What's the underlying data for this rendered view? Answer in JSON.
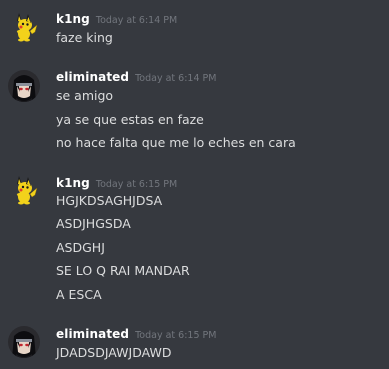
{
  "messages": [
    {
      "username": "k1ng",
      "timestamp": "Today at 6:14 PM",
      "avatar": "pikachu-avatar-icon",
      "lines": [
        "faze king"
      ]
    },
    {
      "username": "eliminated",
      "timestamp": "Today at 6:14 PM",
      "avatar": "itachi-avatar-icon",
      "lines": [
        "se amigo",
        "ya se que estas en faze",
        "no hace falta que me lo eches en cara"
      ]
    },
    {
      "username": "k1ng",
      "timestamp": "Today at 6:15 PM",
      "avatar": "pikachu-avatar-icon",
      "lines": [
        "HGJKDSAGHJDSA",
        "ASDJHGSDA",
        "ASDGHJ",
        "SE LO Q RAI MANDAR",
        "A ESCA"
      ]
    },
    {
      "username": "eliminated",
      "timestamp": "Today at 6:15 PM",
      "avatar": "itachi-avatar-icon",
      "lines": [
        "JDADSDJAWJDAWD"
      ]
    }
  ],
  "colors": {
    "background": "#36393f",
    "username": "#ffffff",
    "timestamp": "#72767d",
    "message_text": "#dcddde"
  }
}
